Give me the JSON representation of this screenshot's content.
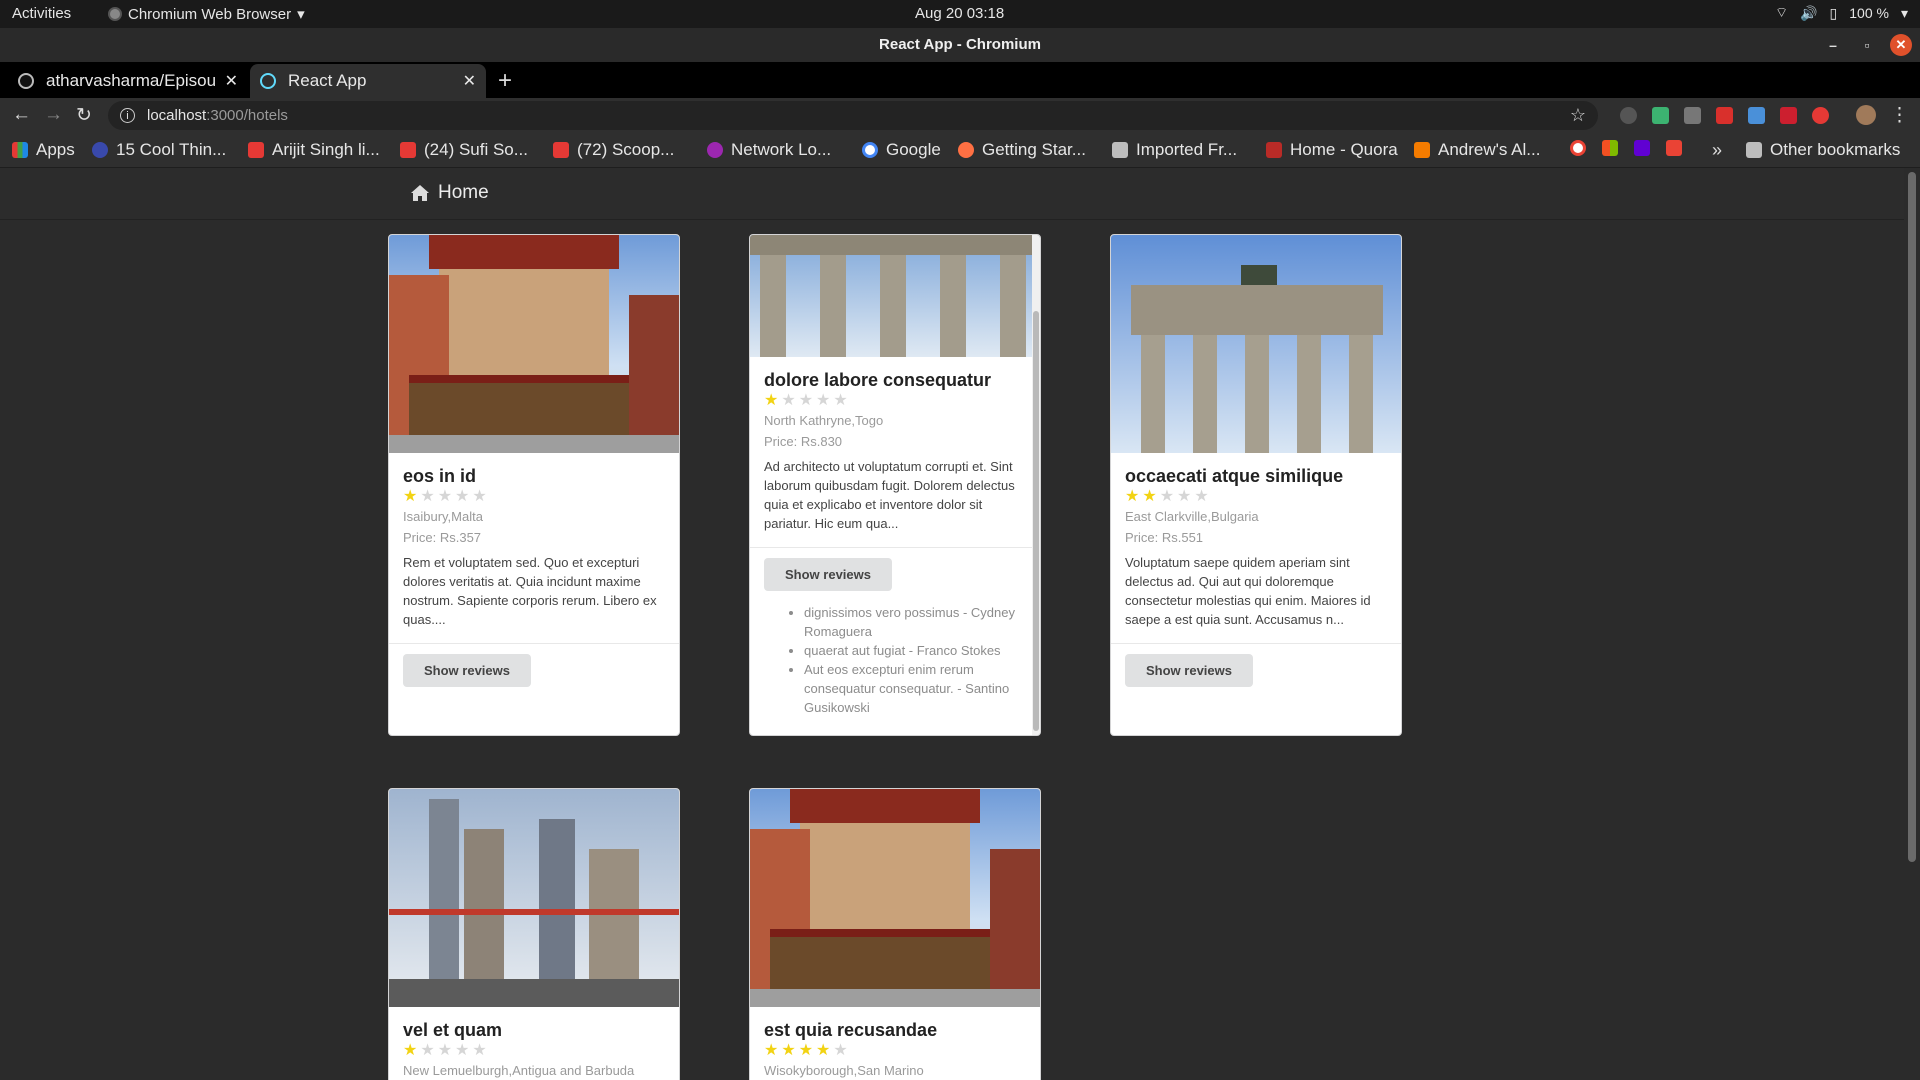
{
  "os": {
    "activities": "Activities",
    "app_menu": "Chromium Web Browser",
    "clock": "Aug 20  03:18",
    "battery": "100 %"
  },
  "window": {
    "title": "React App - Chromium"
  },
  "tabs": [
    {
      "label": "atharvasharma/Episou"
    },
    {
      "label": "React App"
    }
  ],
  "address": {
    "host": "localhost",
    "path": ":3000/hotels"
  },
  "bookmarks": {
    "apps": "Apps",
    "items": [
      "15 Cool Thin...",
      "Arijit Singh li...",
      "(24) Sufi So...",
      "(72) Scoop...",
      "Network Lo...",
      "Google",
      "Getting Star...",
      "Imported Fr...",
      "Home - Quora",
      "Andrew's Al..."
    ],
    "more": "»",
    "other": "Other bookmarks"
  },
  "page": {
    "nav": {
      "home": "Home"
    },
    "show_reviews_label": "Show reviews",
    "hotels": [
      {
        "name": "eos in id",
        "rating": 1,
        "location": "Isaibury,Malta",
        "price": "Price: Rs.357",
        "description": "Rem et voluptatem sed. Quo et excepturi dolores veritatis at. Quia incidunt maxime nostrum. Sapiente corporis rerum. Libero ex quas...."
      },
      {
        "name": "dolore labore consequatur",
        "rating": 1,
        "location": "North Kathryne,Togo",
        "price": "Price: Rs.830",
        "description": "Ad architecto ut voluptatum corrupti et. Sint laborum quibusdam fugit. Dolorem delectus quia et explicabo et inventore dolor sit pariatur. Hic eum qua...",
        "reviews": [
          "dignissimos vero possimus - Cydney Romaguera",
          "quaerat aut fugiat - Franco Stokes",
          "Aut eos excepturi enim rerum consequatur consequatur. - Santino Gusikowski"
        ]
      },
      {
        "name": "occaecati atque similique",
        "rating": 2,
        "location": "East Clarkville,Bulgaria",
        "price": "Price: Rs.551",
        "description": "Voluptatum saepe quidem aperiam sint delectus ad. Qui aut qui doloremque consectetur molestias qui enim. Maiores id saepe a est quia sunt. Accusamus n..."
      },
      {
        "name": "vel et quam",
        "rating": 1,
        "location": "New Lemuelburgh,Antigua and Barbuda"
      },
      {
        "name": "est quia recusandae",
        "rating": 4,
        "location": "Wisokyborough,San Marino"
      }
    ]
  }
}
